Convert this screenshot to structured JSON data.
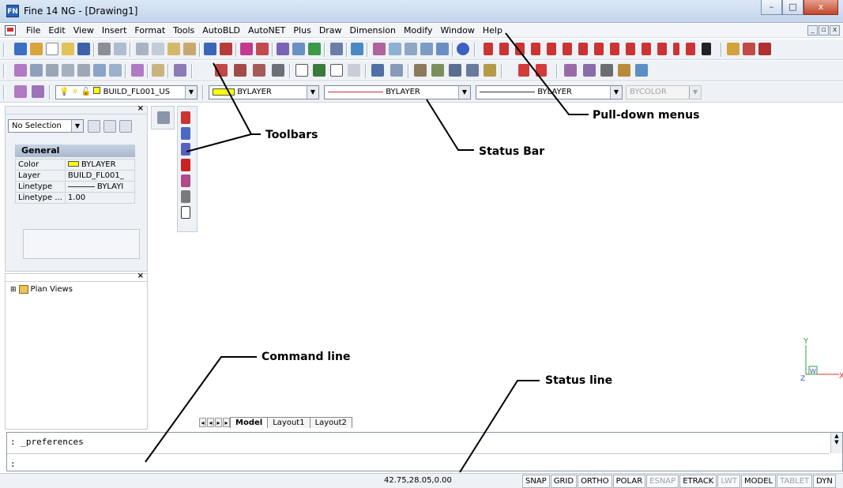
{
  "window": {
    "title": "Fine 14 NG  - [Drawing1]",
    "app_icon": "FN",
    "controls": [
      "–",
      "□",
      "x"
    ]
  },
  "menubar": {
    "items": [
      "File",
      "Edit",
      "View",
      "Insert",
      "Format",
      "Tools",
      "AutoBLD",
      "AutoNET",
      "Plus",
      "Draw",
      "Dimension",
      "Modify",
      "Window",
      "Help"
    ],
    "mdi_controls": [
      "_",
      "▫",
      "x"
    ]
  },
  "layer_bar": {
    "layer_name": "BUILD_FL001_US",
    "color": "BYLAYER",
    "linetype": "BYLAYER",
    "lineweight": "BYLAYER",
    "plotstyle": "BYCOLOR"
  },
  "properties_panel": {
    "selection": "No Selection",
    "section": "General",
    "rows": [
      {
        "key": "Color",
        "value": "BYLAYER"
      },
      {
        "key": "Layer",
        "value": "BUILD_FL001_"
      },
      {
        "key": "Linetype",
        "value": "BYLAYI"
      },
      {
        "key": "Linetype ...",
        "value": "1.00"
      }
    ]
  },
  "tree_panel": {
    "root": "Plan Views"
  },
  "layout_tabs": [
    "Model",
    "Layout1",
    "Layout2"
  ],
  "command": {
    "history": ": _preferences",
    "prompt": ":"
  },
  "status": {
    "coordinates": "42.75,28.05,0.00",
    "toggles": [
      {
        "label": "SNAP",
        "on": true
      },
      {
        "label": "GRID",
        "on": true
      },
      {
        "label": "ORTHO",
        "on": true
      },
      {
        "label": "POLAR",
        "on": true
      },
      {
        "label": "ESNAP",
        "on": false
      },
      {
        "label": "ETRACK",
        "on": true
      },
      {
        "label": "LWT",
        "on": false
      },
      {
        "label": "MODEL",
        "on": true
      },
      {
        "label": "TABLET",
        "on": false
      },
      {
        "label": "DYN",
        "on": true
      }
    ]
  },
  "ucs": {
    "y": "Y",
    "x": "X",
    "w": "W",
    "z": "Z"
  },
  "annotations": {
    "pulldown": "Pull-down menus",
    "toolbars": "Toolbars",
    "statusbar": "Status Bar",
    "command_line": "Command line",
    "status_line": "Status line"
  }
}
